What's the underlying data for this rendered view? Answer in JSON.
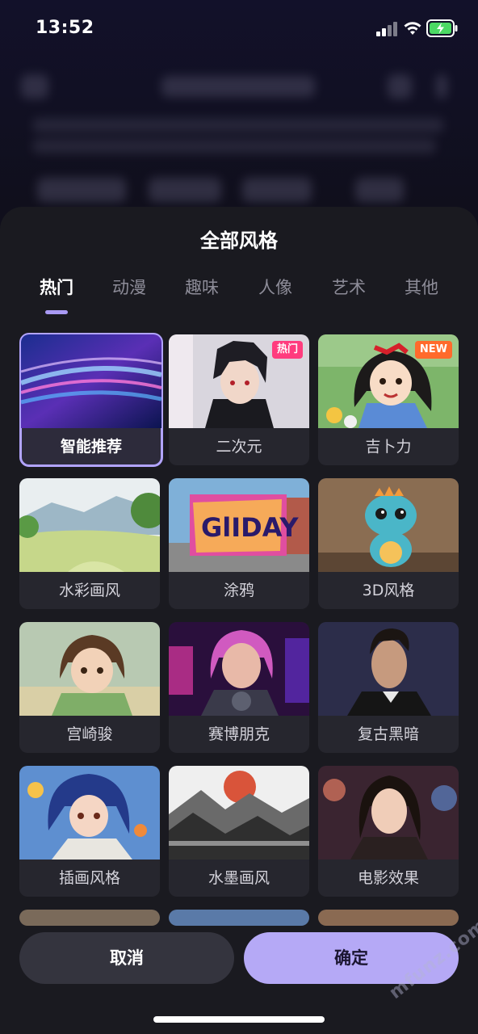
{
  "status_bar": {
    "time": "13:52"
  },
  "sheet": {
    "title": "全部风格",
    "tabs": [
      {
        "label": "热门",
        "active": true
      },
      {
        "label": "动漫",
        "active": false
      },
      {
        "label": "趣味",
        "active": false
      },
      {
        "label": "人像",
        "active": false
      },
      {
        "label": "艺术",
        "active": false
      },
      {
        "label": "其他",
        "active": false
      }
    ],
    "styles": [
      {
        "label": "智能推荐",
        "selected": true
      },
      {
        "label": "二次元",
        "badge": "热门"
      },
      {
        "label": "吉卜力",
        "badge": "NEW"
      },
      {
        "label": "水彩画风"
      },
      {
        "label": "涂鸦"
      },
      {
        "label": "3D风格"
      },
      {
        "label": "宫崎骏"
      },
      {
        "label": "赛博朋克"
      },
      {
        "label": "复古黑暗"
      },
      {
        "label": "插画风格"
      },
      {
        "label": "水墨画风"
      },
      {
        "label": "电影效果"
      }
    ],
    "cancel_label": "取消",
    "confirm_label": "确定"
  },
  "watermark": "mfunz.com",
  "colors": {
    "accent": "#b5a9f6",
    "sheet_bg": "#1a1a20",
    "card_bg": "#26262e",
    "hot_badge": "#ff3c7e",
    "new_badge": "#ff6a2c"
  }
}
